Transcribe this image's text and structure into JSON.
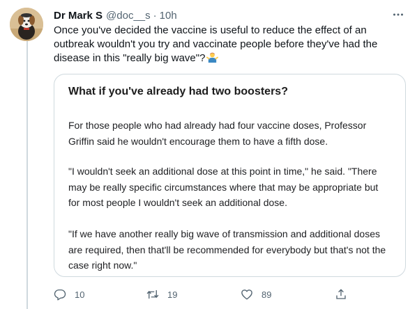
{
  "tweet": {
    "author_name": "Dr Mark S",
    "author_handle": "@doc__s",
    "separator": "·",
    "time": "10h",
    "text_lines": [
      "Once you've decided the vaccine is useful to reduce the effect of an",
      "outbreak wouldn't you try and vaccinate people before they've had the",
      "disease in this \"really big wave\"?"
    ],
    "emoji": "person-shrugging-emoji",
    "more_icon": "more-dots-icon"
  },
  "card": {
    "title": "What if you've already had two boosters?",
    "paragraphs": [
      [
        "For those people who had already had four vaccine doses, Professor",
        "Griffin said he wouldn't encourage them to have a fifth dose."
      ],
      [
        "\"I wouldn't seek an additional dose at this point in time,\" he said. \"There",
        "may be really specific circumstances where that may be appropriate but",
        "for most people I wouldn't seek an additional dose."
      ],
      [
        "\"If we have another really big wave of transmission and additional doses",
        "are required, then that'll be recommended for everybody but that's not the",
        "case right now.\""
      ]
    ]
  },
  "actions": {
    "reply": {
      "icon": "reply-icon",
      "count": "10"
    },
    "retweet": {
      "icon": "retweet-icon",
      "count": "19"
    },
    "like": {
      "icon": "heart-icon",
      "count": "89"
    },
    "share": {
      "icon": "share-icon",
      "count": ""
    }
  },
  "colors": {
    "text": "#0f1419",
    "secondary": "#536471",
    "border": "#cfd9de"
  }
}
